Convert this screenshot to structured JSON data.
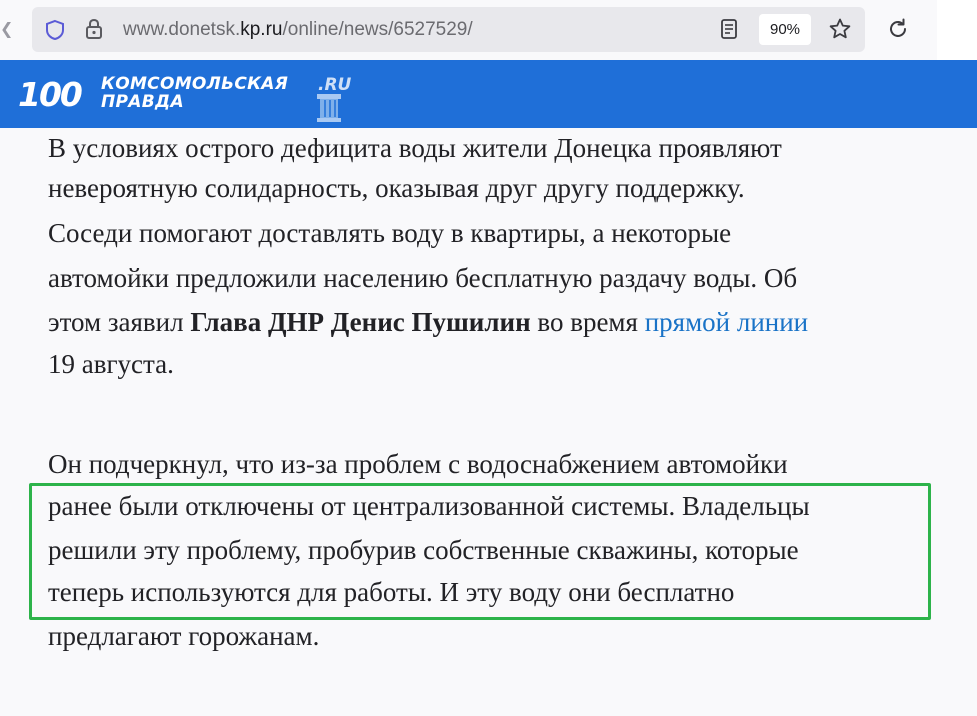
{
  "browser": {
    "url_prefix": "www.donetsk.",
    "url_host": "kp.ru",
    "url_path": "/online/news/6527529/",
    "zoom_level": "90%"
  },
  "site": {
    "logo_number": "100",
    "logo_line1": "КОМСОМОЛЬСКАЯ",
    "logo_line2": "ПРАВДА",
    "logo_ru": ".RU",
    "brand_color": "#1f6fd8"
  },
  "article": {
    "paragraph1": {
      "line1": "В условиях острого дефицита воды жители Донецка проявляют",
      "line2": "невероятную солидарность, оказывая друг другу поддержку.",
      "line3": "Соседи помогают доставлять воду в квартиры, а некоторые",
      "line4": "автомойки предложили населению бесплатную раздачу воды. Об",
      "line5_prefix": "этом заявил ",
      "line5_bold": "Глава ДНР Денис Пушилин",
      "line5_middle": " во время ",
      "line5_link": "прямой линии",
      "line6": "19 августа."
    },
    "paragraph2": {
      "line1": "Он подчеркнул, что из-за проблем с водоснабжением автомойки",
      "line2": "ранее были отключены от централизованной системы. Владельцы",
      "line3": "решили эту проблему, пробурив собственные скважины, которые",
      "line4": "теперь используются для работы. И эту воду они бесплатно",
      "line5": "предлагают горожанам."
    },
    "link_color": "#1a73c7",
    "highlight_color": "#2db34a"
  }
}
